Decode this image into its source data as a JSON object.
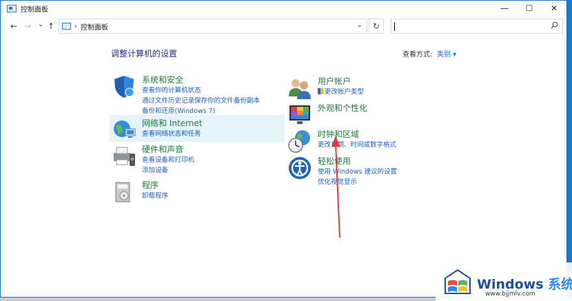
{
  "window": {
    "title": "控制面板",
    "buttons": {
      "minimize": "—",
      "maximize": "☐",
      "close": "✕"
    }
  },
  "nav": {
    "back": "←",
    "forward": "→",
    "recent": "⌄",
    "up": "↑"
  },
  "address": {
    "separator": "›",
    "path": "控制面板",
    "dropdown": "⌄",
    "refresh": "↻"
  },
  "search": {
    "placeholder": "",
    "icon": "search-icon"
  },
  "main": {
    "heading": "调整计算机的设置",
    "view_by_label": "查看方式:",
    "view_by_value": "类别 ▾"
  },
  "categories": [
    {
      "title": "系统和安全",
      "icon": "shield-icon",
      "links": [
        "查看你的计算机状态",
        "通过文件历史记录保存你的文件备份副本",
        "备份和还原(Windows 7)"
      ]
    },
    {
      "title": "网络和 Internet",
      "icon": "network-icon",
      "links": [
        "查看网络状态和任务"
      ]
    },
    {
      "title": "硬件和声音",
      "icon": "printer-icon",
      "links": [
        "查看设备和打印机",
        "添加设备"
      ]
    },
    {
      "title": "程序",
      "icon": "programs-icon",
      "links": [
        "卸载程序"
      ]
    },
    {
      "title": "用户帐户",
      "icon": "users-icon",
      "links": [
        "更改帐户类型"
      ]
    },
    {
      "title": "外观和个性化",
      "icon": "appearance-icon",
      "links": []
    },
    {
      "title": "时钟和区域",
      "icon": "clock-globe-icon",
      "links": [
        "更改日期、时间或数字格式"
      ]
    },
    {
      "title": "轻松使用",
      "icon": "accessibility-icon",
      "links": [
        "使用 Windows 建议的设置",
        "优化视觉显示"
      ]
    }
  ],
  "watermark": {
    "brand": "Windows",
    "brand_cn": "系统之家",
    "url": "www.bjjmlv.com"
  },
  "colors": {
    "title_green": "#1a7f37",
    "link_blue": "#1a5fc8",
    "heading_blue": "#1e3287",
    "annotation_red": "#e03a3a"
  }
}
